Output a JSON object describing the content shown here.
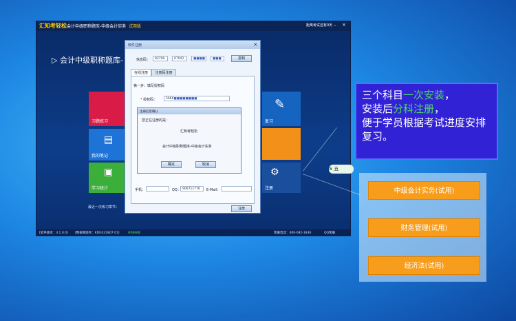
{
  "app": {
    "title": "汇知考轻松",
    "subtitle": "会计中级职称题库-中级会计实务",
    "edition": "试用版",
    "trial_days": "距离考试还有0天",
    "bank_title": "会计中级职称题库-",
    "tiles": {
      "practice": "习题练习",
      "notes": "我的笔记",
      "stats": "学习统计",
      "review": "复习",
      "register": "注册"
    },
    "last_practice": "最近一次练习章节：",
    "status": {
      "version": "[软件版本：3.1.0.0]",
      "db_version": "[数据库版本：KDU031807 01]",
      "upgrade": "在线升级",
      "phone": "客服电话：400-082-1836",
      "qq": "QQ客服"
    }
  },
  "reg_dialog": {
    "title": "软件注册",
    "info_label": "信息码：",
    "info_code_1": "83799",
    "info_code_2": "07042",
    "copy_button": "复制",
    "tabs": [
      "在线注册",
      "注册码注册"
    ],
    "step1": "第一步：填写授权码",
    "auth_label": "授权码：",
    "auth_value": "5666",
    "phone_label": "手机：",
    "qq_label": "QQ：",
    "qq_value": "906711776",
    "email_label": "E-Mail：",
    "register_button": "注册"
  },
  "confirm_dialog": {
    "title": "注册信息确认",
    "prompt": "您正在注册的是：",
    "company": "汇知考轻松",
    "product": "会计中级职称题库-中级会计实务",
    "ok": "确定",
    "cancel": "取消"
  },
  "promo": {
    "line1a": "三个科目",
    "line1b": "一次安装",
    "line1c": "，",
    "line2a": "安装后",
    "line2b": "分科注册",
    "line2c": "，",
    "line3": "便于学员根据考试进度安排",
    "line4": "复习。"
  },
  "subjects": [
    "中级会计实务(试用)",
    "财务管理(试用)",
    "经济法(试用)"
  ],
  "badge": "五",
  "colors": {
    "accent_orange": "#f79c1b",
    "promo_bg": "#3222d6",
    "highlight": "#4cd964"
  }
}
